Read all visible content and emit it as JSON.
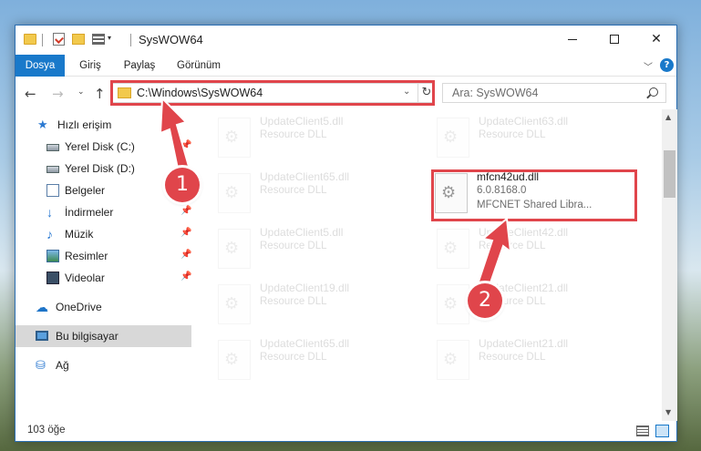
{
  "window": {
    "title": "SysWOW64",
    "controls": {
      "minimize": "",
      "maximize": "",
      "close": "✕"
    }
  },
  "ribbon": {
    "tabs": [
      "Dosya",
      "Giriş",
      "Paylaş",
      "Görünüm"
    ],
    "help": "?"
  },
  "address": {
    "path": "C:\\Windows\\SysWOW64",
    "search_placeholder": "Ara: SysWOW64"
  },
  "sidebar": {
    "items": [
      {
        "label": "Hızlı erişim",
        "icon": "star-icon",
        "pinned": false
      },
      {
        "label": "Yerel Disk (C:)",
        "icon": "disk-icon",
        "pinned": true
      },
      {
        "label": "Yerel Disk (D:)",
        "icon": "disk-icon",
        "pinned": false
      },
      {
        "label": "Belgeler",
        "icon": "document-icon",
        "pinned": false
      },
      {
        "label": "İndirmeler",
        "icon": "download-icon",
        "pinned": true
      },
      {
        "label": "Müzik",
        "icon": "music-icon",
        "pinned": true
      },
      {
        "label": "Resimler",
        "icon": "pictures-icon",
        "pinned": true
      },
      {
        "label": "Videolar",
        "icon": "videos-icon",
        "pinned": true
      },
      {
        "label": "OneDrive",
        "icon": "cloud-icon",
        "pinned": false
      },
      {
        "label": "Bu bilgisayar",
        "icon": "computer-icon",
        "pinned": false,
        "selected": true
      },
      {
        "label": "Ağ",
        "icon": "network-icon",
        "pinned": false
      }
    ]
  },
  "files": [
    {
      "name": "UpdateClient5.dll",
      "type": "Resource DLL",
      "faded": true
    },
    {
      "name": "UpdateClient63.dll",
      "type": "Resource DLL",
      "faded": true
    },
    {
      "name": "UpdateClient65.dll",
      "type": "Resource DLL",
      "faded": true
    },
    {
      "name": "mfcn42ud.dll",
      "version": "6.0.8168.0",
      "type": "MFCNET Shared Libra...",
      "faded": false
    },
    {
      "name": "UpdateClient5.dll",
      "type": "Resource DLL",
      "faded": true
    },
    {
      "name": "UpdateClient42.dll",
      "type": "Resource DLL",
      "faded": true
    },
    {
      "name": "UpdateClient19.dll",
      "type": "Resource DLL",
      "faded": true
    },
    {
      "name": "UpdateClient21.dll",
      "type": "Resource DLL",
      "faded": true
    },
    {
      "name": "UpdateClient65.dll",
      "type": "Resource DLL",
      "faded": true
    },
    {
      "name": "UpdateClient21.dll",
      "type": "Resource DLL",
      "faded": true
    }
  ],
  "status": {
    "item_count": "103 öğe"
  },
  "annotations": {
    "step1": "1",
    "step2": "2",
    "color": "#e0454b"
  },
  "colors": {
    "accent": "#1979ca",
    "highlight": "#e0454b",
    "selected_bg": "#d8d8d8"
  }
}
